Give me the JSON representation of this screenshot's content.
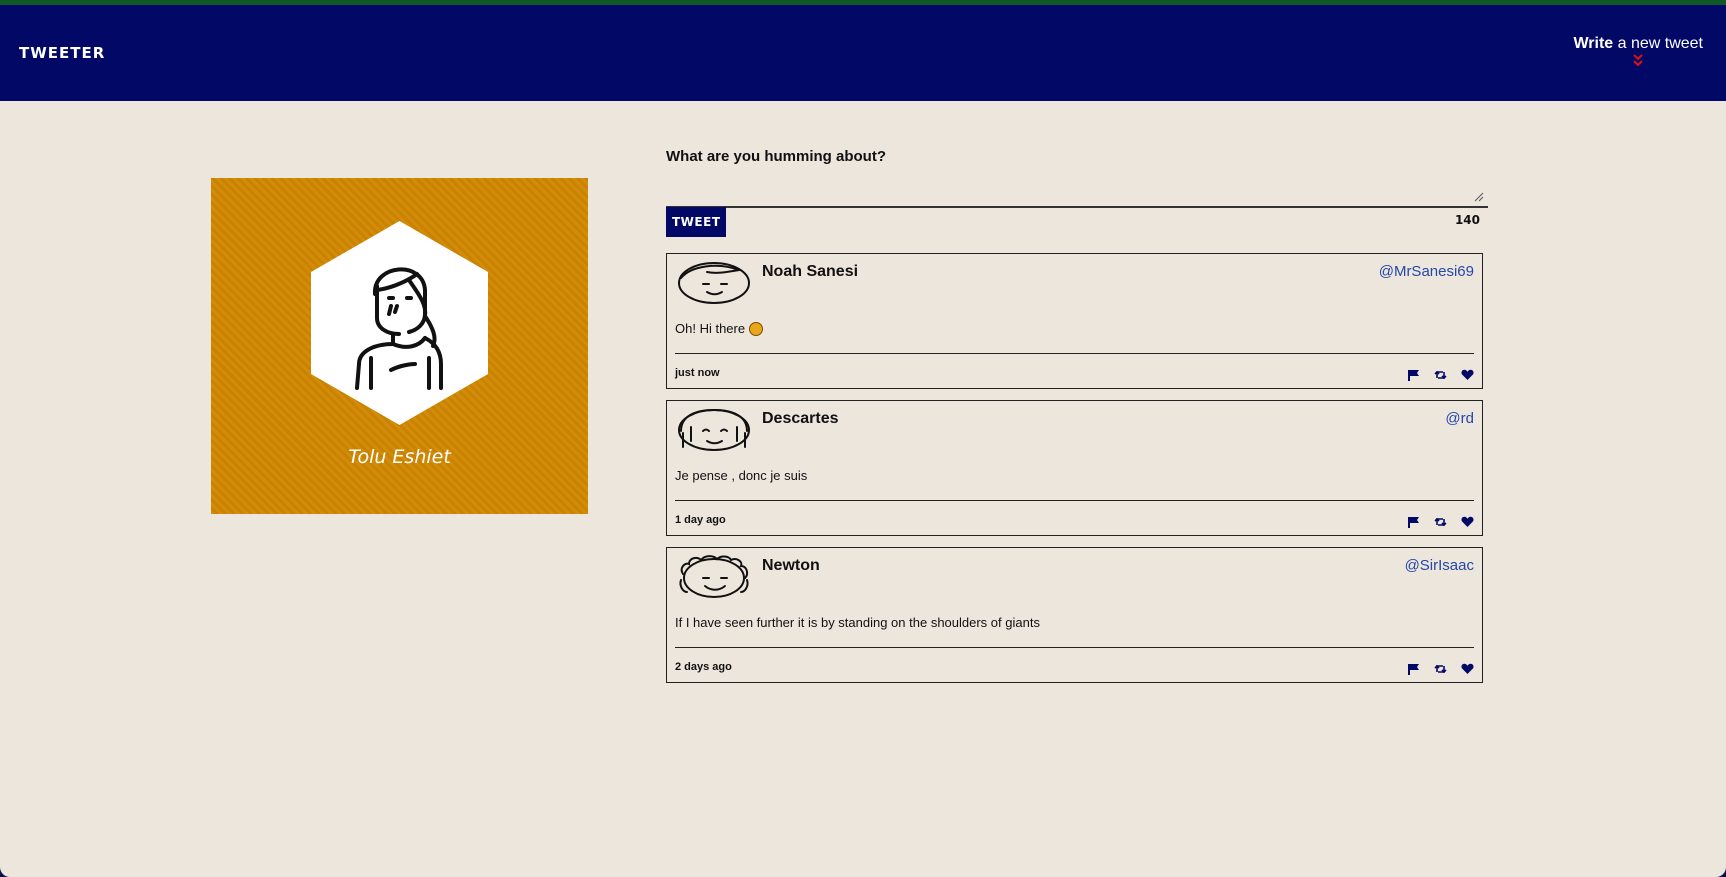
{
  "app": {
    "brand": "TWEETER"
  },
  "nav": {
    "compose_bold": "Write",
    "compose_rest": " a new tweet"
  },
  "profile": {
    "name": "Tolu Eshiet"
  },
  "composer": {
    "prompt": "What are you humming about?",
    "button": "TWEET",
    "counter": "140"
  },
  "tweets": [
    {
      "name": "Noah Sanesi",
      "handle": "@MrSanesi69",
      "text": "Oh! Hi there ",
      "emoji": "grinning-face",
      "time": "just now"
    },
    {
      "name": "Descartes",
      "handle": "@rd",
      "text": "Je pense , donc je suis",
      "time": "1 day ago"
    },
    {
      "name": "Newton",
      "handle": "@SirIsaac",
      "text": "If I have seen further it is by standing on the shoulders of giants",
      "time": "2 days ago"
    }
  ],
  "icons": {
    "actions": [
      "flag-icon",
      "retweet-icon",
      "heart-icon"
    ]
  },
  "colors": {
    "nav": "#020866",
    "accent": "#d08700",
    "handle": "#2447a8",
    "chevron": "#d11"
  }
}
